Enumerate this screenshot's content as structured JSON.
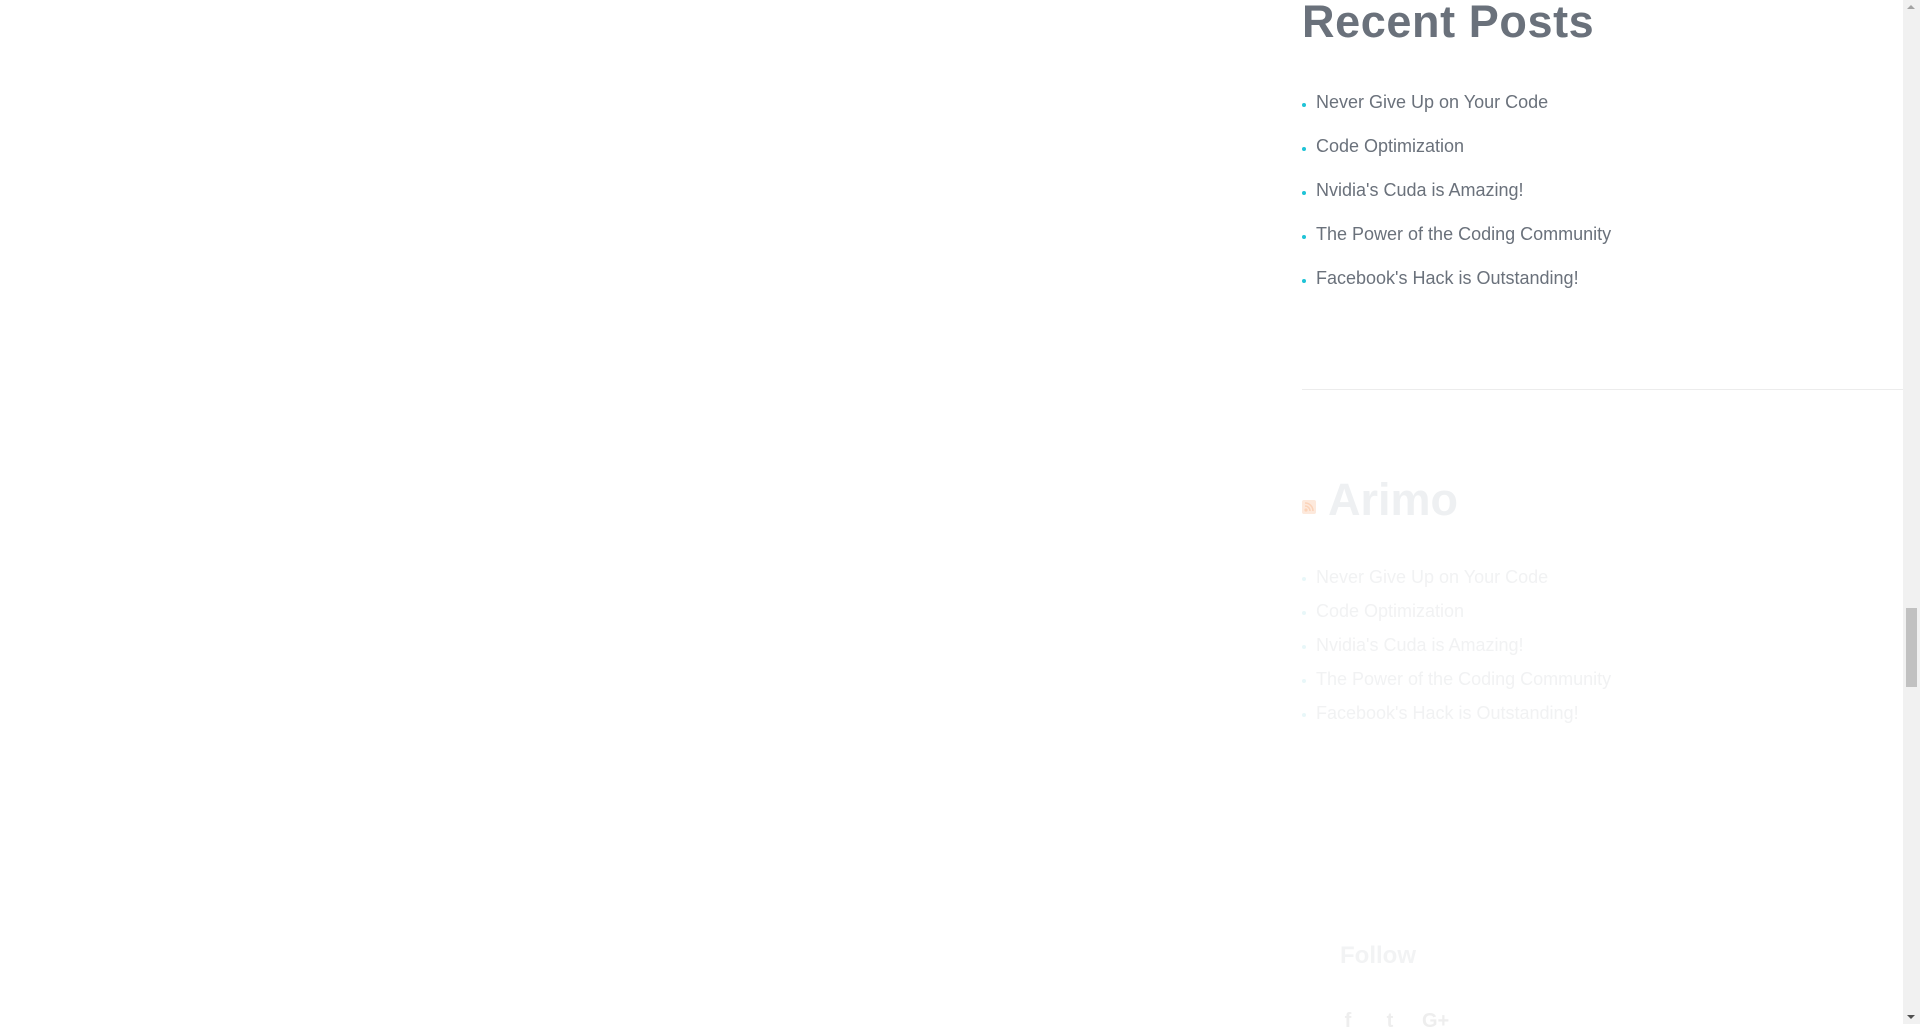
{
  "recent_posts": {
    "title": "Recent Posts",
    "items": [
      "Never Give Up on Your Code",
      "Code Optimization",
      "Nvidia's Cuda is Amazing!",
      "The Power of the Coding Community",
      "Facebook's Hack is Outstanding!"
    ]
  },
  "rss_widget": {
    "title": "Arimo",
    "icon": "rss-icon",
    "items": [
      "Never Give Up on Your Code",
      "Code Optimization",
      "Nvidia's Cuda is Amazing!",
      "The Power of the Coding Community",
      "Facebook's Hack is Outstanding!"
    ]
  },
  "follow": {
    "title": "Follow",
    "icons": [
      "facebook-icon",
      "twitter-icon",
      "google-plus-icon"
    ],
    "glyphs": [
      "f",
      "t",
      "G+"
    ]
  },
  "colors": {
    "accent": "#1fc3d6",
    "heading": "#6a717b"
  }
}
